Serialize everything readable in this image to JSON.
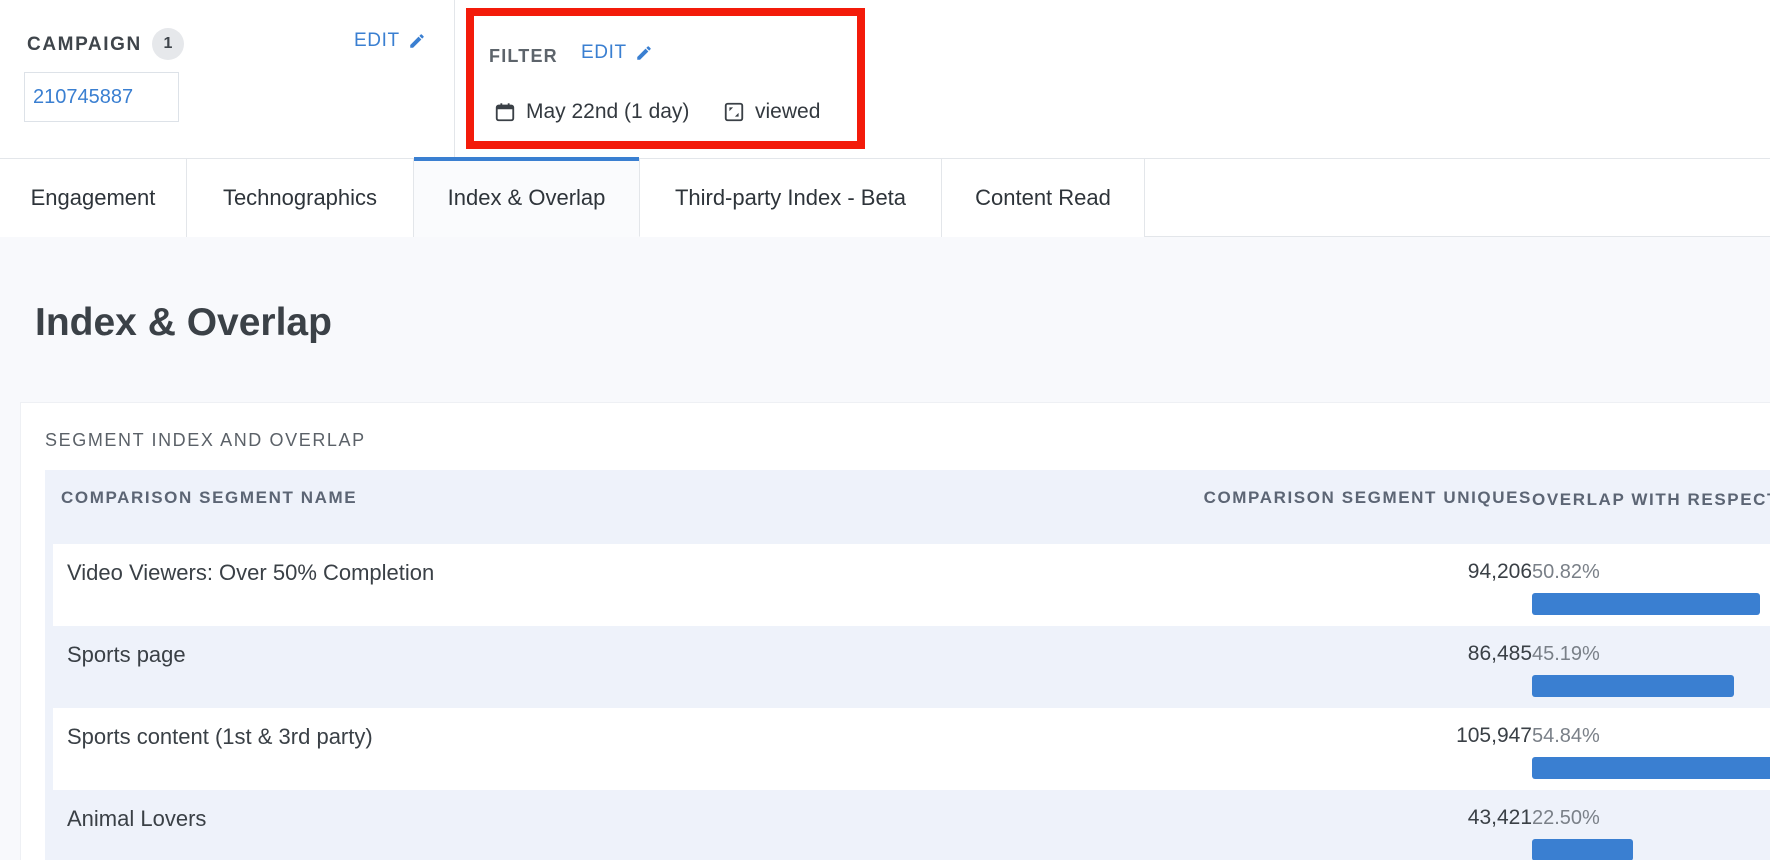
{
  "campaign": {
    "label": "CAMPAIGN",
    "count": "1",
    "edit_label": "EDIT",
    "id": "210745887"
  },
  "filter": {
    "label": "FILTER",
    "edit_label": "EDIT",
    "date": "May 22nd (1 day)",
    "view": "viewed",
    "highlight_color": "#f31b0a"
  },
  "tabs": [
    {
      "label": "Engagement",
      "active": false
    },
    {
      "label": "Technographics",
      "active": false
    },
    {
      "label": "Index & Overlap",
      "active": true
    },
    {
      "label": "Third-party Index - Beta",
      "active": false
    },
    {
      "label": "Content Read",
      "active": false
    }
  ],
  "main": {
    "title": "Index & Overlap",
    "card_title": "SEGMENT INDEX AND OVERLAP",
    "columns": [
      "COMPARISON SEGMENT NAME",
      "COMPARISON SEGMENT UNIQUES",
      "OVERLAP WITH RESPECT TO UNIQUES"
    ],
    "rows": [
      {
        "name": "Video Viewers: Over 50% Completion",
        "uniques": "94,206",
        "overlap": "50.82%",
        "overlap_value": 50.82
      },
      {
        "name": "Sports page",
        "uniques": "86,485",
        "overlap": "45.19%",
        "overlap_value": 45.19
      },
      {
        "name": "Sports content (1st & 3rd party)",
        "uniques": "105,947",
        "overlap": "54.84%",
        "overlap_value": 54.84
      },
      {
        "name": "Animal Lovers",
        "uniques": "43,421",
        "overlap": "22.50%",
        "overlap_value": 22.5
      }
    ]
  },
  "colors": {
    "accent": "#3a7fd1",
    "bar": "#3a7fd1",
    "row_alt": "#eef2fa"
  },
  "icons": {
    "edit": "pencil-icon",
    "date": "calendar-icon",
    "view": "viewed-icon"
  }
}
